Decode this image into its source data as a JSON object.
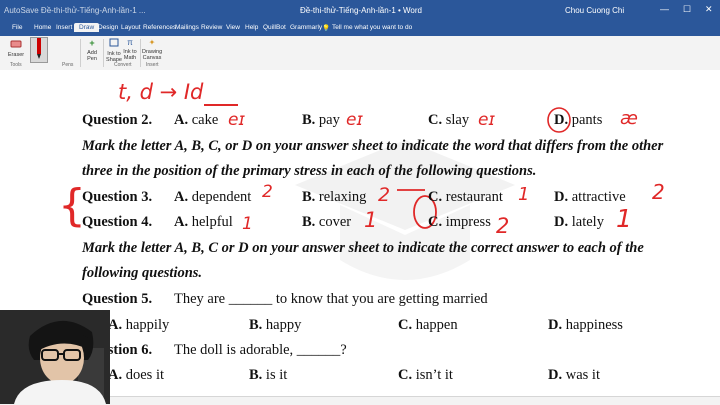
{
  "titlebar": {
    "quick_access": "AutoSave  Đề-thi-thử-Tiếng-Anh-lần-1 ...",
    "doc_title": "Đề-thi-thử-Tiếng-Anh-lần-1 • Word",
    "user": "Chou Cuong Chi",
    "minimize": "—",
    "maximize": "☐",
    "close": "✕"
  },
  "tabs": [
    "File",
    "Home",
    "Insert",
    "Draw",
    "Design",
    "Layout",
    "References",
    "Mailings",
    "Review",
    "View",
    "Help",
    "QuillBot",
    "Grammarly"
  ],
  "tell_me": "Tell me what you want to do",
  "ribbon": {
    "eraser": "Eraser",
    "tools_group": "Tools",
    "pens_group": "Pens",
    "add_pen": "Add Pen",
    "ink_to_shape": "Ink to Shape",
    "ink_to_math": "Ink to Math",
    "drawing_canvas": "Drawing Canvas",
    "convert_group": "Convert",
    "insert_group": "Insert"
  },
  "document": {
    "q2": {
      "label": "Question 2.",
      "a": "cake",
      "b": "pay",
      "c": "slay",
      "d": "pants"
    },
    "instr1_line1": "Mark the letter A, B, C, or D on your answer sheet to indicate the word that differs from the other",
    "instr1_line2": "three in the position of the primary stress in each of the following questions.",
    "q3": {
      "label": "Question 3.",
      "a": "dependent",
      "b": "relaxing",
      "c": "restaurant",
      "d": "attractive"
    },
    "q4": {
      "label": "Question 4.",
      "a": "helpful",
      "b": "cover",
      "c": "impress",
      "d": "lately"
    },
    "instr2_line1": "Mark the letter A, B, C or D on your answer sheet to indicate the correct answer to each of the",
    "instr2_line2": "following questions.",
    "q5": {
      "label": "Question 5.",
      "stem": "They are ______ to know that you are getting married",
      "a": "happily",
      "b": "happy",
      "c": "happen",
      "d": "happiness"
    },
    "q6": {
      "label": "Question 6.",
      "stem": "The doll is adorable, ______?",
      "a": "does it",
      "b": "is it",
      "c": "isn’t it",
      "d": "was it"
    },
    "letters": {
      "a": "A.",
      "b": "B.",
      "c": "C.",
      "d": "D."
    }
  },
  "ink": {
    "top": "t, d → Id",
    "q2a": "eɪ",
    "q2b": "eɪ",
    "q2c": "eɪ",
    "q2d": "æ",
    "q3a": "2",
    "q3b": "2",
    "q3c": "1",
    "q3d": "2",
    "q4a": "1",
    "q4b": "1",
    "q4c": "2",
    "q4d": "1"
  },
  "colors": {
    "word_blue": "#2b579a",
    "ink_red": "#e02828"
  }
}
